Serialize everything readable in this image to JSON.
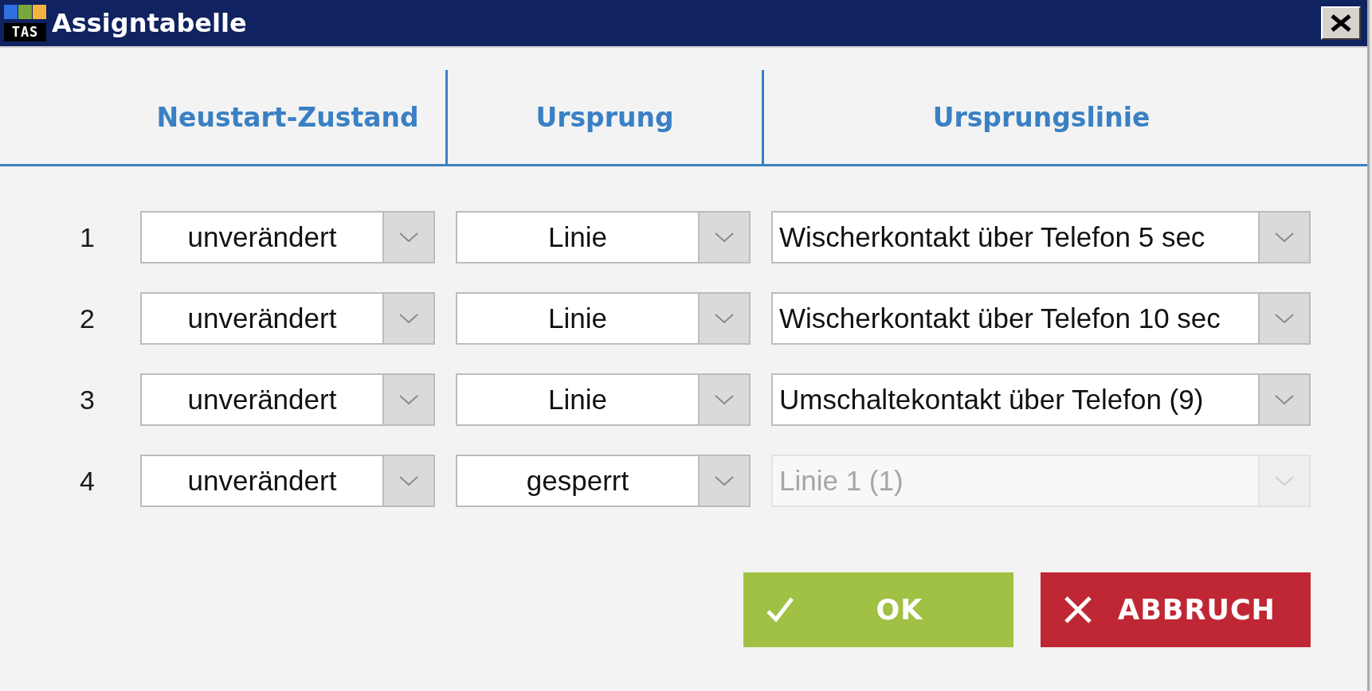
{
  "window": {
    "logo_text": "TAS",
    "title": "Assigntabelle"
  },
  "table": {
    "columns": [
      "Neustart-Zustand",
      "Ursprung",
      "Ursprungslinie"
    ],
    "rows": [
      {
        "number": "1",
        "restart_state": {
          "value": "unverändert",
          "disabled": false
        },
        "origin": {
          "value": "Linie",
          "disabled": false
        },
        "origin_line": {
          "value": "Wischerkontakt über Telefon 5 sec",
          "disabled": false
        }
      },
      {
        "number": "2",
        "restart_state": {
          "value": "unverändert",
          "disabled": false
        },
        "origin": {
          "value": "Linie",
          "disabled": false
        },
        "origin_line": {
          "value": "Wischerkontakt über Telefon 10 sec",
          "disabled": false
        }
      },
      {
        "number": "3",
        "restart_state": {
          "value": "unverändert",
          "disabled": false
        },
        "origin": {
          "value": "Linie",
          "disabled": false
        },
        "origin_line": {
          "value": "Umschaltekontakt über Telefon (9)",
          "disabled": false
        }
      },
      {
        "number": "4",
        "restart_state": {
          "value": "unverändert",
          "disabled": false
        },
        "origin": {
          "value": "gesperrt",
          "disabled": false
        },
        "origin_line": {
          "value": "Linie 1 (1)",
          "disabled": true
        }
      }
    ]
  },
  "buttons": [
    {
      "label": "OK",
      "kind": "confirm"
    },
    {
      "label": "ABBRUCH",
      "kind": "cancel"
    }
  ]
}
